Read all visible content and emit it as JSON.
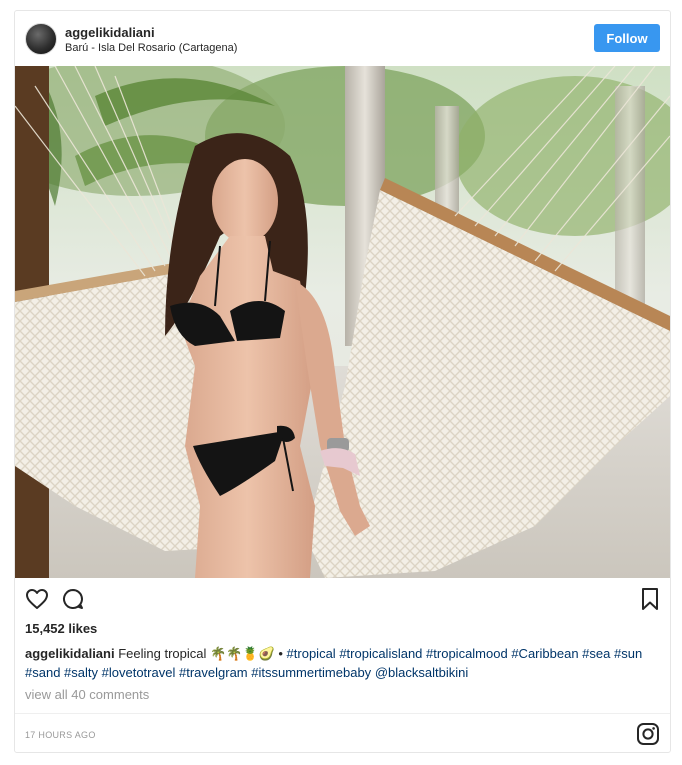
{
  "post": {
    "username": "aggelikidaliani",
    "location": "Barú - Isla Del Rosario (Cartagena)",
    "follow_label": "Follow",
    "likes": "15,452 likes",
    "caption_username": "aggelikidaliani",
    "caption_text": "Feeling tropical",
    "caption_emoji": "🌴🌴🍍🥑 •",
    "hashtags_line1": [
      "#tropical",
      "#tropicalisland",
      "#tropicalmood",
      "#Caribbean",
      "#sea"
    ],
    "hashtags_line2": [
      "#sun",
      "#sand",
      "#salty",
      "#lovetotravel",
      "#travelgram",
      "#itssummertimebaby",
      "@blacksaltbikini"
    ],
    "view_comments": "view all 40 comments",
    "timestamp": "17 HOURS AGO"
  },
  "icons": {
    "like": "heart-icon",
    "comment": "comment-icon",
    "save": "bookmark-icon",
    "logo": "instagram-icon"
  },
  "colors": {
    "follow_button": "#3897f0",
    "hashtag": "#003569",
    "muted": "#999999"
  }
}
